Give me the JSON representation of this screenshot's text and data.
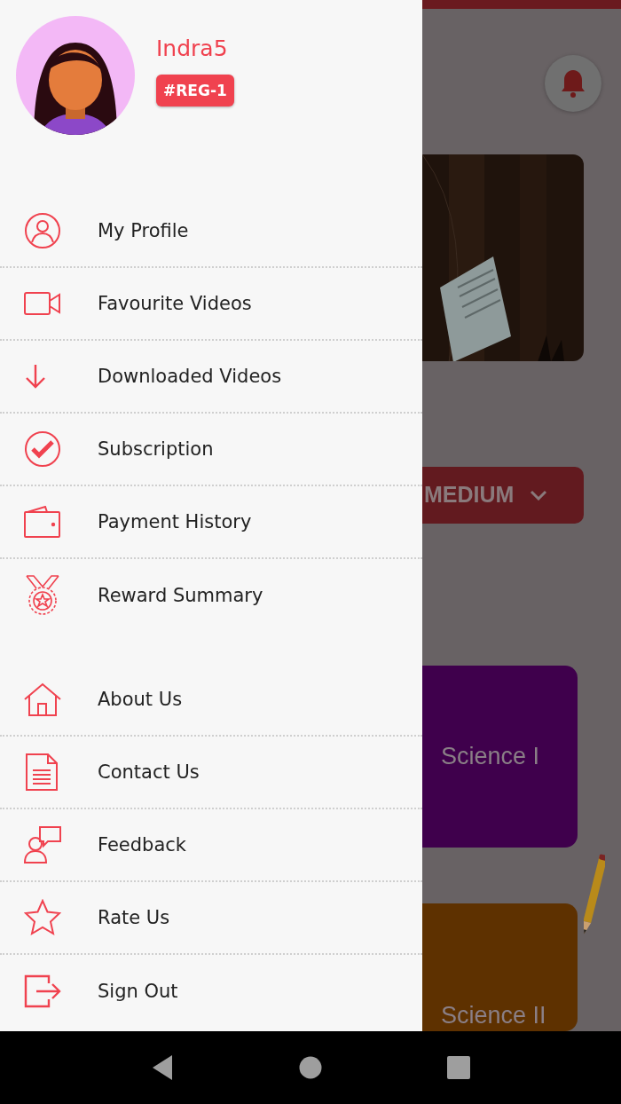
{
  "drawer": {
    "profile": {
      "name": "Indra5",
      "badge": "#REG-1"
    },
    "menu_groups": [
      [
        {
          "label": "My Profile"
        },
        {
          "label": "Favourite Videos"
        },
        {
          "label": "Downloaded Videos"
        },
        {
          "label": "Subscription"
        },
        {
          "label": "Payment History"
        },
        {
          "label": "Reward Summary"
        }
      ],
      [
        {
          "label": "About Us"
        },
        {
          "label": "Contact Us"
        },
        {
          "label": "Feedback"
        },
        {
          "label": "Rate Us"
        },
        {
          "label": "Sign Out"
        }
      ]
    ]
  },
  "background_screen": {
    "class_dropdown": {
      "value": "MEDIUM"
    },
    "subject_cards": [
      {
        "title": "Science I",
        "color": "#3f004c"
      },
      {
        "title": "Science II",
        "color": "#5e3100"
      }
    ]
  }
}
